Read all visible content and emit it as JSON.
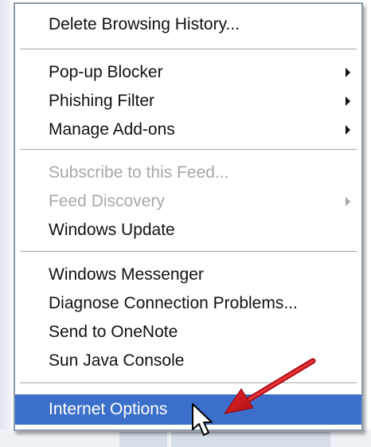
{
  "menu": {
    "items": [
      {
        "label": "Delete Browsing History...",
        "enabled": true,
        "has_submenu": false
      },
      {
        "label": "Pop-up Blocker",
        "enabled": true,
        "has_submenu": true
      },
      {
        "label": "Phishing Filter",
        "enabled": true,
        "has_submenu": true
      },
      {
        "label": "Manage Add-ons",
        "enabled": true,
        "has_submenu": true
      },
      {
        "label": "Subscribe to this Feed...",
        "enabled": false,
        "has_submenu": false
      },
      {
        "label": "Feed Discovery",
        "enabled": false,
        "has_submenu": true
      },
      {
        "label": "Windows Update",
        "enabled": true,
        "has_submenu": false
      },
      {
        "label": "Windows Messenger",
        "enabled": true,
        "has_submenu": false
      },
      {
        "label": "Diagnose Connection Problems...",
        "enabled": true,
        "has_submenu": false
      },
      {
        "label": "Send to OneNote",
        "enabled": true,
        "has_submenu": false
      },
      {
        "label": "Sun Java Console",
        "enabled": true,
        "has_submenu": false
      },
      {
        "label": "Internet Options",
        "enabled": true,
        "has_submenu": false,
        "highlighted": true
      }
    ]
  },
  "colors": {
    "highlight": "#3b6fc9",
    "disabled_text": "#a8a8a8",
    "annotation_arrow": "#d0191f"
  },
  "icons": {
    "cursor": "arrow-cursor-icon",
    "annotation": "red-arrow-icon",
    "submenu": "chevron-right-icon"
  }
}
